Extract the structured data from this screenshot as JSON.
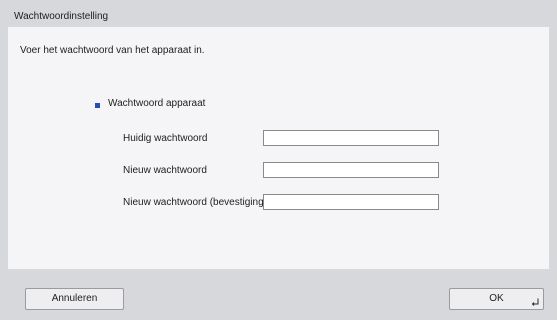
{
  "window": {
    "title": "Wachtwoordinstelling"
  },
  "instruction": "Voer het wachtwoord van het apparaat in.",
  "section": {
    "label": "Wachtwoord apparaat",
    "marker_color": "#2a4db3"
  },
  "fields": [
    {
      "label": "Huidig wachtwoord",
      "value": ""
    },
    {
      "label": "Nieuw wachtwoord",
      "value": ""
    },
    {
      "label": "Nieuw wachtwoord (bevestiging)",
      "value": ""
    }
  ],
  "buttons": {
    "cancel": "Annuleren",
    "ok": "OK",
    "ok_icon": "enter-icon"
  }
}
